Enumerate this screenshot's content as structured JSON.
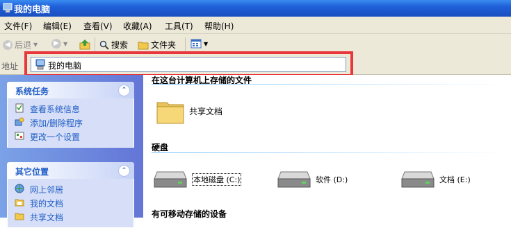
{
  "window": {
    "title": "我的电脑"
  },
  "menu": [
    "文件(F)",
    "编辑(E)",
    "查看(V)",
    "收藏(A)",
    "工具(T)",
    "帮助(H)"
  ],
  "toolbar": {
    "back": "后退",
    "search": "搜索",
    "folders": "文件夹"
  },
  "address": {
    "label": "地址",
    "value": "我的电脑"
  },
  "sidebar": {
    "system_tasks": {
      "title": "系统任务",
      "links": [
        "查看系统信息",
        "添加/删除程序",
        "更改一个设置"
      ]
    },
    "other_places": {
      "title": "其它位置",
      "links": [
        "网上邻居",
        "我的文档",
        "共享文档"
      ]
    }
  },
  "content": {
    "files_header": "在这台计算机上存储的文件",
    "shared_docs": "共享文档",
    "disks_header": "硬盘",
    "drives": [
      {
        "label": "本地磁盘 (C:)"
      },
      {
        "label": "软件 (D:)"
      },
      {
        "label": "文档 (E:)"
      }
    ],
    "removable_header": "有可移动存储的设备"
  },
  "colors": {
    "highlight_box": "#e8383d",
    "title_bar": "#1f5fd8",
    "sidebar_link": "#215dc6"
  }
}
